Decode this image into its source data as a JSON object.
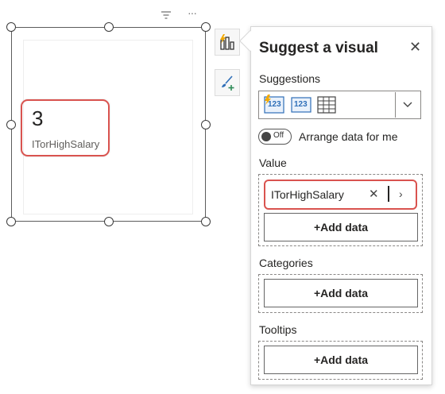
{
  "card": {
    "value": "3",
    "label": "ITorHighSalary"
  },
  "visual_header": {
    "filter_icon": "filter-icon",
    "more_icon": "more-options-icon",
    "more_glyph": "···"
  },
  "panel": {
    "title": "Suggest a visual",
    "close_glyph": "✕",
    "suggestions_label": "Suggestions",
    "suggestion_glyphs": [
      "123",
      "123"
    ],
    "toggle_state": "Off",
    "toggle_label": "Arrange data for me",
    "value_label": "Value",
    "value_field": "ITorHighSalary",
    "remove_glyph": "✕",
    "expand_glyph": "›",
    "add_data": "+Add data",
    "categories_label": "Categories",
    "tooltips_label": "Tooltips",
    "dropdown_glyph": "⌵"
  },
  "colors": {
    "highlight": "#d9534f",
    "accent_orange": "#f2a900",
    "accent_blue": "#2f6fb8"
  }
}
